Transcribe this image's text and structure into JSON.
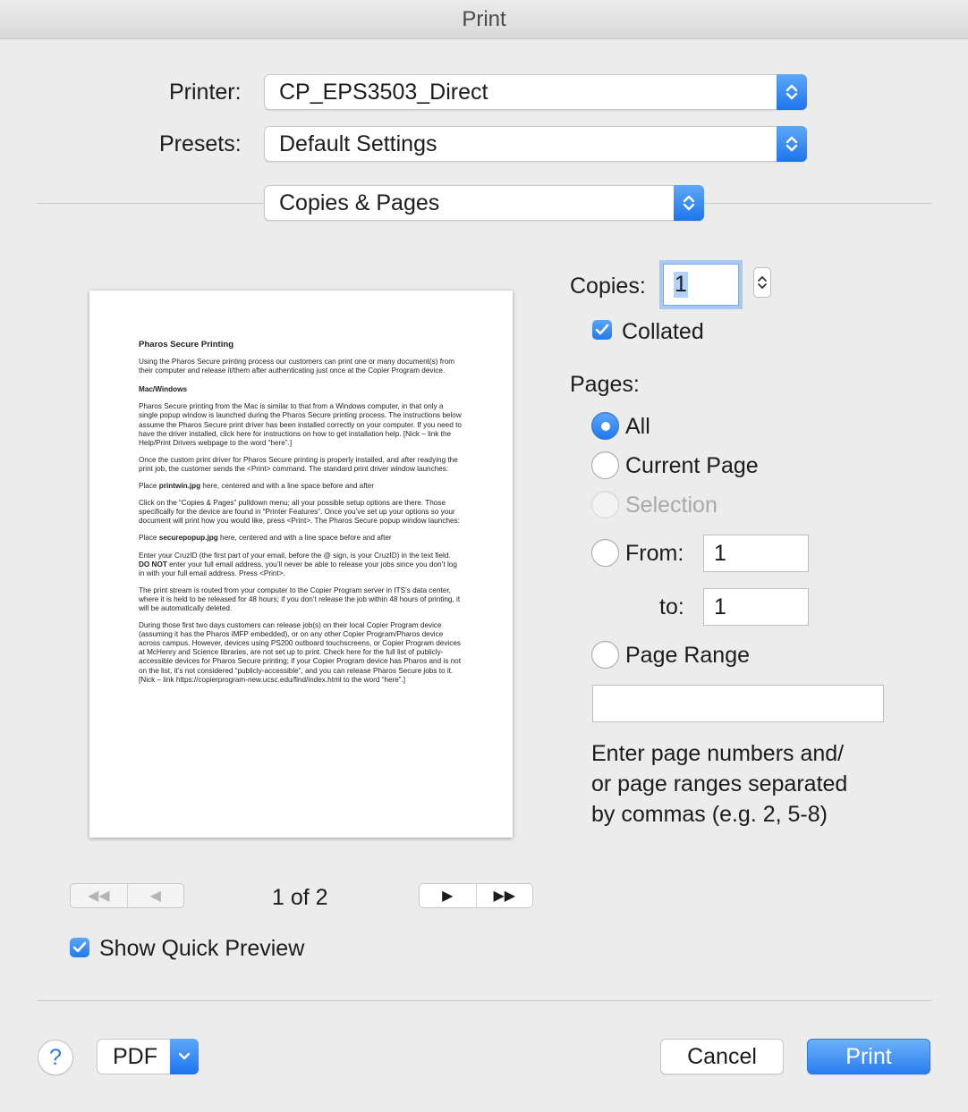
{
  "window": {
    "title": "Print"
  },
  "printer": {
    "label": "Printer:",
    "value": "CP_EPS3503_Direct"
  },
  "presets": {
    "label": "Presets:",
    "value": "Default Settings"
  },
  "section": {
    "value": "Copies & Pages"
  },
  "preview": {
    "heading": "Pharos Secure Printing",
    "intro": "Using the Pharos Secure printing process our customers can print one or many document(s) from their computer and release it/them after authenticating just once at the Copier Program device.",
    "subheading": "Mac/Windows",
    "p1": "Pharos Secure printing from the Mac is similar to that from a Windows computer, in that only a single popup window is launched during the Pharos Secure printing process. The instructions below assume the Pharos Secure print driver has been installed correctly on your computer.  If you need to have the driver installed, click here for instructions on how to get installation help. [Nick – link the Help/Print Drivers webpage to the word “here”.]",
    "p2": "Once the custom print driver for Pharos Secure printing is properly installed, and after readying the print job, the customer sends the <Print> command.  The standard print driver window launches:",
    "p3_pre": "Place ",
    "p3_bold": "printwin.jpg",
    "p3_post": " here, centered and with a line space before and after",
    "p4": "Click on the “Copies & Pages” pulldown menu; all your possible setup options are there. Those specifically for the device are found in “Printer Features”.  Once you’ve set up your options so your document will print how you would like, press <Print>.  The Pharos Secure popup window launches:",
    "p5_pre": "Place ",
    "p5_bold": "securepopup.jpg",
    "p5_post": " here, centered and with a line space before and after",
    "p6_pre": "Enter your CruzID (the first part of your email, before the @ sign, is your CruzID) in the text field.  ",
    "p6_bold": "DO NOT",
    "p6_post": " enter your full email address, you’ll never be able to release your jobs since you don’t log in with your full email address.  Press <Print>.",
    "p7": "The print stream is routed from your computer to the Copier Program server in ITS’s data center, where it is held to be released for 48 hours; if you don’t release the job within 48 hours of printing, it will be automatically deleted.",
    "p8": "During those first two days customers can release job(s) on their local Copier Program device (assuming it has the Pharos iMFP embedded), or on any other Copier Program/Pharos device across campus.  However, devices using PS200 outboard touchscreens, or Copier Program devices at McHenry and Science libraries, are not set up to print.  Check here for the full list of publicly-accessible devices for Pharos Secure printing; if your Copier Program device has Pharos and is not on the list, it’s not considered “publicly-accessible”, and you can release Pharos Secure jobs to it.  [Nick – link https://copierprogram-new.ucsc.edu/find/index.html to the word “here”.]"
  },
  "navigation": {
    "page_indicator": "1 of 2",
    "first_icon": "◀◀",
    "prev_icon": "◀",
    "next_icon": "▶",
    "last_icon": "▶▶"
  },
  "copies": {
    "label": "Copies:",
    "value": "1",
    "collated_label": "Collated",
    "collated": true
  },
  "pages": {
    "label": "Pages:",
    "all_label": "All",
    "current_label": "Current Page",
    "selection_label": "Selection",
    "from_label": "From:",
    "from_value": "1",
    "to_label": "to:",
    "to_value": "1",
    "range_label": "Page Range",
    "range_value": "",
    "selected": "All",
    "help_line1": "Enter page numbers and/",
    "help_line2": "or page ranges separated",
    "help_line3": "by commas (e.g. 2, 5-8)"
  },
  "quick_preview": {
    "label": "Show Quick Preview",
    "checked": true
  },
  "footer": {
    "help_label": "?",
    "pdf_label": "PDF",
    "cancel_label": "Cancel",
    "print_label": "Print"
  },
  "colors": {
    "accent": "#2a7ef0",
    "background": "#ececec"
  }
}
